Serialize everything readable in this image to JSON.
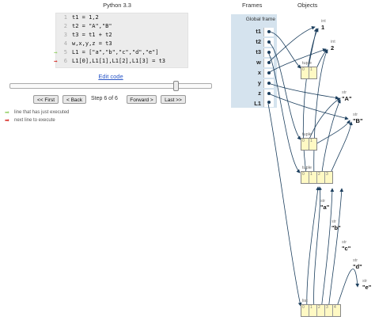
{
  "editor": {
    "language": "Python 3.3",
    "lines": [
      {
        "num": "1",
        "code": "t1 = 1,2"
      },
      {
        "num": "2",
        "code": "t2 = \"A\",\"B\""
      },
      {
        "num": "3",
        "code": "t3 = t1 + t2"
      },
      {
        "num": "4",
        "code": "w,x,y,z = t3"
      },
      {
        "num": "5",
        "code": "L1 = [\"a\",\"b\",\"c\",\"d\",\"e\"]"
      },
      {
        "num": "6",
        "code": "L1[0],L1[1],L1[2],L1[3] = t3"
      }
    ],
    "edit_link": "Edit code",
    "prev_arrow_color": "#9bd36f",
    "next_arrow_color": "#d8322c"
  },
  "navigation": {
    "first": "<< First",
    "back": "< Back",
    "step_label": "Step 6 of 6",
    "forward": "Forward >",
    "last": "Last >>",
    "progress": 1.0
  },
  "legend": {
    "prev_line": "line that has just executed",
    "next_line": "next line to execute"
  },
  "viz": {
    "frames_header": "Frames",
    "objects_header": "Objects",
    "global_frame": "Global frame",
    "variables": [
      "t1",
      "t2",
      "t3",
      "w",
      "x",
      "y",
      "z",
      "L1"
    ],
    "primitives": [
      {
        "type": "int",
        "value": "1"
      },
      {
        "type": "int",
        "value": "2"
      },
      {
        "type": "str",
        "value": "\"A\""
      },
      {
        "type": "str",
        "value": "\"B\""
      },
      {
        "type": "str",
        "value": "\"a\""
      },
      {
        "type": "str",
        "value": "\"b\""
      },
      {
        "type": "str",
        "value": "\"c\""
      },
      {
        "type": "str",
        "value": "\"d\""
      },
      {
        "type": "str",
        "value": "\"e\""
      }
    ],
    "tuples": [
      {
        "label": "tuple",
        "indices": [
          "0",
          "1"
        ]
      },
      {
        "label": "tuple",
        "indices": [
          "0",
          "1"
        ]
      },
      {
        "label": "tuple",
        "indices": [
          "0",
          "1",
          "2",
          "3"
        ]
      }
    ],
    "list": {
      "label": "list",
      "indices": [
        "0",
        "1",
        "2",
        "3",
        "4"
      ]
    },
    "arrow_color": "#1c3f5e",
    "frame_color": "#d5e3ee",
    "object_color": "#fff9c4"
  }
}
